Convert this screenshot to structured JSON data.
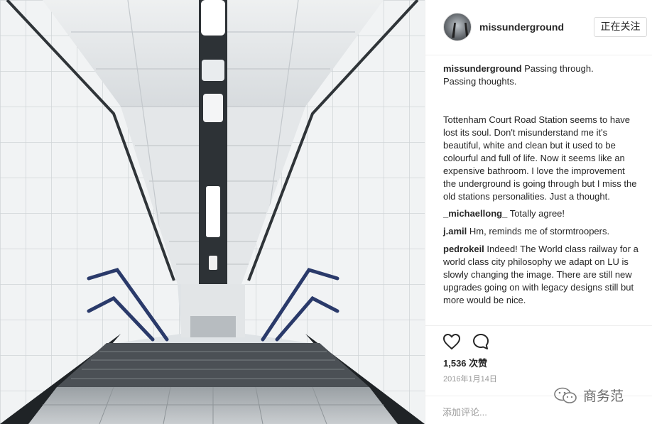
{
  "post": {
    "username": "missunderground",
    "follow_label": "正在关注",
    "caption_text": "Passing through.\nPassing thoughts.\n\n\nTottenham Court Road Station seems to have lost its soul. Don't misunderstand me it's beautiful, white and clean but it used to be colourful and full of life. Now it seems like an expensive bathroom. I love the improvement the underground is going through but I miss the old stations personalities. Just a thought.",
    "comments": [
      {
        "user": "_michaellong_",
        "text": "Totally agree!"
      },
      {
        "user": "j.amil",
        "text": "Hm, reminds me of stormtroopers."
      },
      {
        "user": "pedrokeil",
        "text": "Indeed! The World class railway for a world class city philosophy we adapt on LU is slowly changing the image. There are still new upgrades going on with legacy designs still but more would be nice."
      }
    ],
    "likes": "1,536 次赞",
    "date": "2016年1月14日",
    "add_comment_placeholder": "添加评论...",
    "watermark_text": "商务范"
  },
  "icons": {
    "like": "heart-icon",
    "comment": "comment-icon",
    "watermark": "wechat-icon"
  }
}
